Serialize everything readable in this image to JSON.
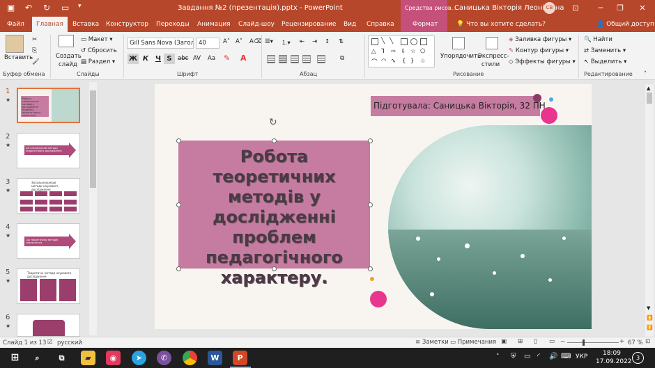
{
  "titlebar": {
    "document_title": "Завдання №2 (презентація).pptx - PowerPoint",
    "context_group": "Средства рисов...",
    "user_name": "Саницька Вікторія Леонідівна",
    "user_initials": "СВ"
  },
  "tabs": [
    "Файл",
    "Главная",
    "Вставка",
    "Конструктор",
    "Переходы",
    "Анимация",
    "Слайд-шоу",
    "Рецензирование",
    "Вид",
    "Справка",
    "Формат"
  ],
  "active_tab": "Главная",
  "tell_me": "Что вы хотите сделать?",
  "share": "Общий доступ",
  "ribbon": {
    "clipboard": {
      "paste": "Вставить",
      "label": "Буфер обмена"
    },
    "slides": {
      "new_slide": "Создать",
      "new_slide2": "слайд",
      "layout": "Макет",
      "reset": "Сбросить",
      "section": "Раздел",
      "label": "Слайды"
    },
    "font": {
      "font_name": "Gill Sans Nova (Заголо",
      "font_size": "40",
      "bold": "Ж",
      "italic": "К",
      "underline": "Ч",
      "shadow": "S",
      "strike": "abc",
      "spacing": "AV",
      "case": "Aa",
      "label": "Шрифт"
    },
    "paragraph": {
      "label": "Абзац"
    },
    "drawing": {
      "arrange": "Упорядочить",
      "quick_styles": "Экспресс-",
      "quick_styles2": "стили",
      "fill": "Заливка фигуры",
      "outline": "Контур фигуры",
      "effects": "Эффекты фигуры",
      "label": "Рисование"
    },
    "editing": {
      "find": "Найти",
      "replace": "Заменить",
      "select": "Выделить",
      "label": "Редактирование"
    }
  },
  "thumbnails": [
    {
      "num": "1",
      "text": "Робота теоретичних методів у дослідженні проблем педагогічного характеру."
    },
    {
      "num": "2",
      "text": "Загальнонаукові методи педагогічного дослідження"
    },
    {
      "num": "3",
      "text": "Загальнонаукові методи наукового дослідження"
    },
    {
      "num": "4",
      "text": "До теоретичних методів відносяться"
    },
    {
      "num": "5",
      "text": "Теоретичні методи наукового дослідження"
    },
    {
      "num": "6",
      "text": ""
    }
  ],
  "slide": {
    "title": "Робота теоретичних методів у дослідженні проблем педагогічного характеру.",
    "subtitle": "Підготувала: Саницька Вікторія, 32 ПН"
  },
  "status": {
    "slide_counter": "Слайд 1 из 13",
    "language": "русский",
    "notes": "Заметки",
    "comments": "Примечания",
    "zoom": "67 %"
  },
  "taskbar": {
    "lang": "УКР",
    "time": "18:09",
    "date": "17.09.2022",
    "notif_count": "3"
  },
  "colors": {
    "accent": "#b7472a",
    "context": "#c5507a",
    "title_box": "#c67ca1",
    "pink_dot": "#e8368f"
  }
}
